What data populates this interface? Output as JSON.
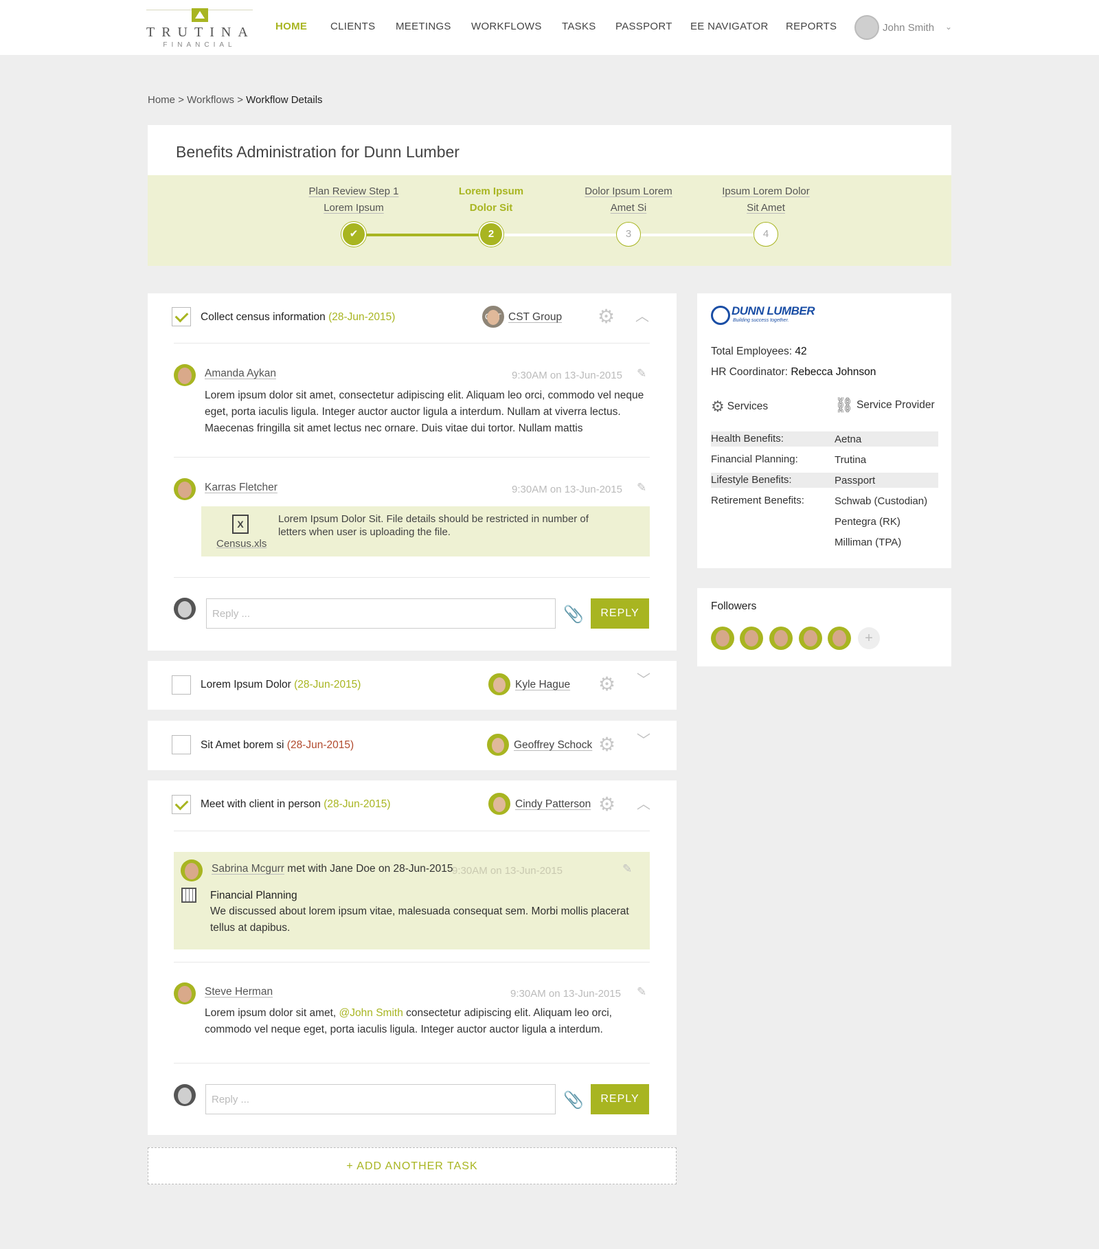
{
  "header": {
    "logo_word": "TRUTINA",
    "logo_sub": "FINANCIAL",
    "nav": [
      "HOME",
      "CLIENTS",
      "MEETINGS",
      "WORKFLOWS",
      "TASKS",
      "PASSPORT",
      "EE NAVIGATOR",
      "REPORTS"
    ],
    "user_name": "John Smith"
  },
  "breadcrumb": {
    "home": "Home",
    "workflows": "Workflows",
    "current": "Workflow Details",
    "sep": ">"
  },
  "workflow": {
    "title": "Benefits Administration for Dunn Lumber",
    "steps": [
      {
        "line1": "Plan Review Step 1",
        "line2": "Lorem Ipsum",
        "state": "done",
        "num": "✔"
      },
      {
        "line1": "Lorem Ipsum",
        "line2": "Dolor Sit",
        "state": "active",
        "num": "2"
      },
      {
        "line1": "Dolor Ipsum Lorem",
        "line2": "Amet Si",
        "state": "todo",
        "num": "3"
      },
      {
        "line1": "Ipsum Lorem Dolor",
        "line2": "Sit Amet",
        "state": "todo",
        "num": "4"
      }
    ]
  },
  "tasks": [
    {
      "title": "Collect census information",
      "date": "(28-Jun-2015)",
      "assignee": "CST Group",
      "assignee_initials": "CST",
      "comments": [
        {
          "name": "Amanda Aykan",
          "time": "9:30AM on 13-Jun-2015",
          "body": "Lorem ipsum dolor sit amet, consectetur adipiscing elit. Aliquam leo orci, commodo vel neque eget, porta iaculis ligula. Integer auctor auctor ligula a interdum. Nullam at viverra lectus. Maecenas fringilla sit amet lectus nec ornare. Duis vitae dui tortor. Nullam mattis"
        },
        {
          "name": "Karras Fletcher",
          "time": "9:30AM on 13-Jun-2015",
          "file_name": "Census.xls",
          "file_desc": "Lorem Ipsum Dolor Sit. File details should be restricted in number of letters when user is uploading the file."
        }
      ],
      "reply_placeholder": "Reply ...",
      "reply_label": "REPLY"
    },
    {
      "title": "Lorem Ipsum Dolor",
      "date": "(28-Jun-2015)",
      "assignee": "Kyle Hague"
    },
    {
      "title": "Sit Amet borem si",
      "date": "(28-Jun-2015)",
      "assignee": "Geoffrey Schock"
    },
    {
      "title": "Meet with client in person",
      "date": "(28-Jun-2015)",
      "assignee": "Cindy Patterson",
      "meeting": {
        "name": "Sabrina Mcgurr",
        "text": "met with Jane Doe on 28-Jun-2015",
        "time": "9:30AM on 13-Jun-2015",
        "topic": "Financial Planning",
        "body": "We discussed about lorem ipsum vitae, malesuada consequat sem. Morbi mollis placerat tellus at dapibus."
      },
      "comment": {
        "name": "Steve Herman",
        "time": "9:30AM on 13-Jun-2015",
        "body_pre": "Lorem ipsum dolor sit amet, ",
        "mention": "@John Smith",
        "body_post": " consectetur adipiscing elit. Aliquam leo orci, commodo vel neque eget, porta iaculis ligula. Integer auctor auctor ligula a interdum."
      },
      "reply_placeholder": "Reply ...",
      "reply_label": "REPLY"
    }
  ],
  "add_task": "+ ADD ANOTHER TASK",
  "company": {
    "logo_name": "DUNN LUMBER",
    "logo_tagline": "Building success together.",
    "employees_label": "Total Employees:",
    "employees": "42",
    "coordinator_label": "HR Coordinator:",
    "coordinator": "Rebecca Johnson",
    "services_head": "Services",
    "provider_head": "Service Provider",
    "services": [
      {
        "k": "Health Benefits:",
        "v": "Aetna"
      },
      {
        "k": "Financial Planning:",
        "v": "Trutina"
      },
      {
        "k": "Lifestyle Benefits:",
        "v": "Passport"
      },
      {
        "k": "Retirement Benefits:",
        "v": "Schwab (Custodian)"
      },
      {
        "k": "",
        "v": "Pentegra (RK)"
      },
      {
        "k": "",
        "v": "Milliman (TPA)"
      }
    ]
  },
  "followers": {
    "title": "Followers",
    "add": "+"
  },
  "colors": {
    "accent": "#a8b521",
    "panel": "#eef1d3",
    "overdue": "#b14a2e",
    "page_bg": "#eeeeee"
  }
}
